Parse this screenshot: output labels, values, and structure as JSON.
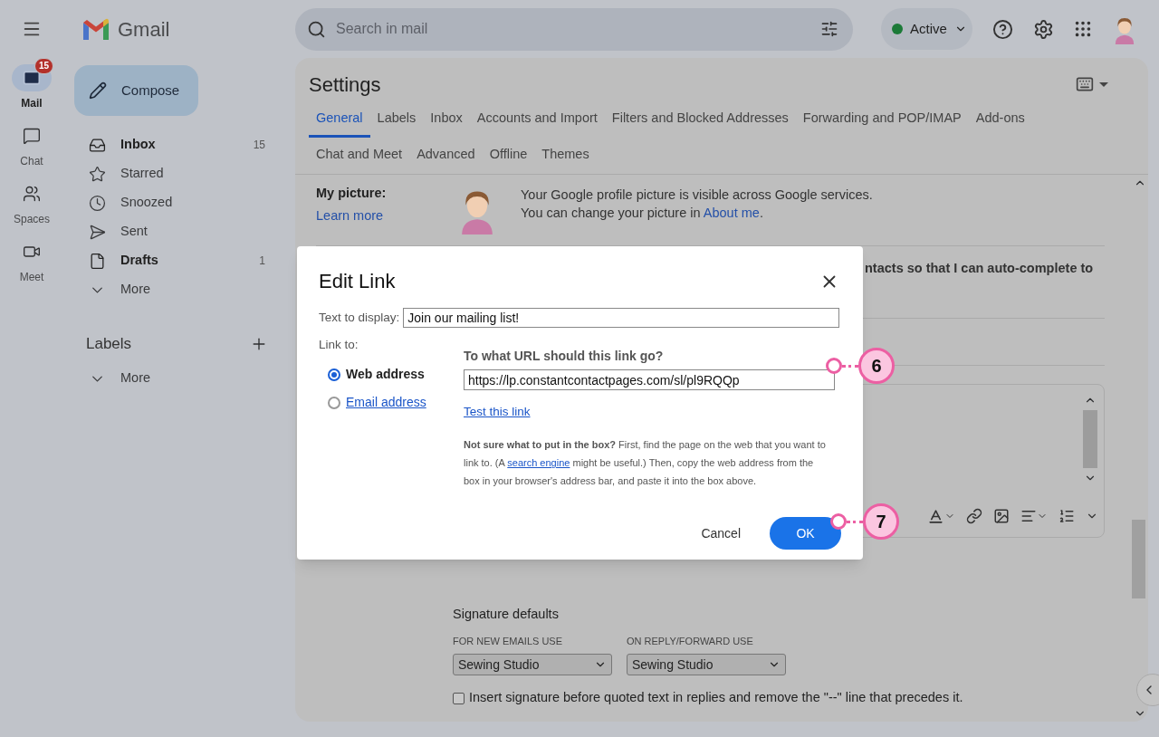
{
  "app_name": "Gmail",
  "rail": [
    {
      "label": "Mail",
      "kind": "mail",
      "selected": true,
      "badge": "15"
    },
    {
      "label": "Chat",
      "kind": "chat",
      "selected": false
    },
    {
      "label": "Spaces",
      "kind": "spaces",
      "selected": false
    },
    {
      "label": "Meet",
      "kind": "meet",
      "selected": false
    }
  ],
  "compose": "Compose",
  "nav": [
    {
      "label": "Inbox",
      "kind": "inbox",
      "unread": true,
      "count": "15"
    },
    {
      "label": "Starred",
      "kind": "star",
      "unread": false
    },
    {
      "label": "Snoozed",
      "kind": "clock",
      "unread": false
    },
    {
      "label": "Sent",
      "kind": "send",
      "unread": false
    },
    {
      "label": "Drafts",
      "kind": "draft",
      "unread": true,
      "count": "1"
    },
    {
      "label": "More",
      "kind": "more",
      "unread": false
    }
  ],
  "labels": {
    "heading": "Labels",
    "more": "More"
  },
  "search": {
    "placeholder": "Search in mail"
  },
  "status": {
    "label": "Active"
  },
  "settings": {
    "title": "Settings",
    "tab_rows": [
      [
        {
          "label": "General",
          "selected": true
        },
        {
          "label": "Labels",
          "selected": false
        },
        {
          "label": "Inbox",
          "selected": false
        },
        {
          "label": "Accounts and Import",
          "selected": false
        },
        {
          "label": "Filters and Blocked Addresses",
          "selected": false
        },
        {
          "label": "Forwarding and POP/IMAP",
          "selected": false
        },
        {
          "label": "Add-ons",
          "selected": false
        }
      ],
      [
        {
          "label": "Chat and Meet",
          "selected": false
        },
        {
          "label": "Advanced",
          "selected": false
        },
        {
          "label": "Offline",
          "selected": false
        },
        {
          "label": "Themes",
          "selected": false
        }
      ]
    ],
    "my_picture": {
      "label": "My picture:",
      "link": "Learn more",
      "line1": "Your Google profile picture is visible across Google services.",
      "line2": "You can change your picture in ",
      "line2_link": "About me",
      "line2_end": "."
    },
    "contacts_text": "ntacts so that I can auto-complete to",
    "signature_defaults": {
      "heading": "Signature defaults",
      "selects": [
        {
          "label": "FOR NEW EMAILS USE",
          "value": "Sewing Studio"
        },
        {
          "label": "ON REPLY/FORWARD USE",
          "value": "Sewing Studio"
        }
      ],
      "insert_option": {
        "label": "Insert signature before quoted text in replies and remove the \"--\" line that precedes it.",
        "checked": false
      }
    }
  },
  "dialog": {
    "title": "Edit Link",
    "display_label": "Text to display:",
    "display_value": "Join our mailing list!",
    "link_to_label": "Link to:",
    "link_types": [
      {
        "label": "Web address",
        "selected": true
      },
      {
        "label": "Email address",
        "selected": false
      }
    ],
    "url_label": "To what URL should this link go?",
    "url_value": "https://lp.constantcontactpages.com/sl/pl9RQQp",
    "test_link": "Test this link",
    "help_bold": "Not sure what to put in the box?",
    "help_1": " First, find the page on the web that you want to link to. (A ",
    "help_link": "search engine",
    "help_2": " might be useful.) Then, copy the web address from the box in your browser's address bar, and paste it into the box above.",
    "cancel": "Cancel",
    "ok": "OK"
  },
  "callouts": [
    {
      "number": "6"
    },
    {
      "number": "7"
    }
  ]
}
